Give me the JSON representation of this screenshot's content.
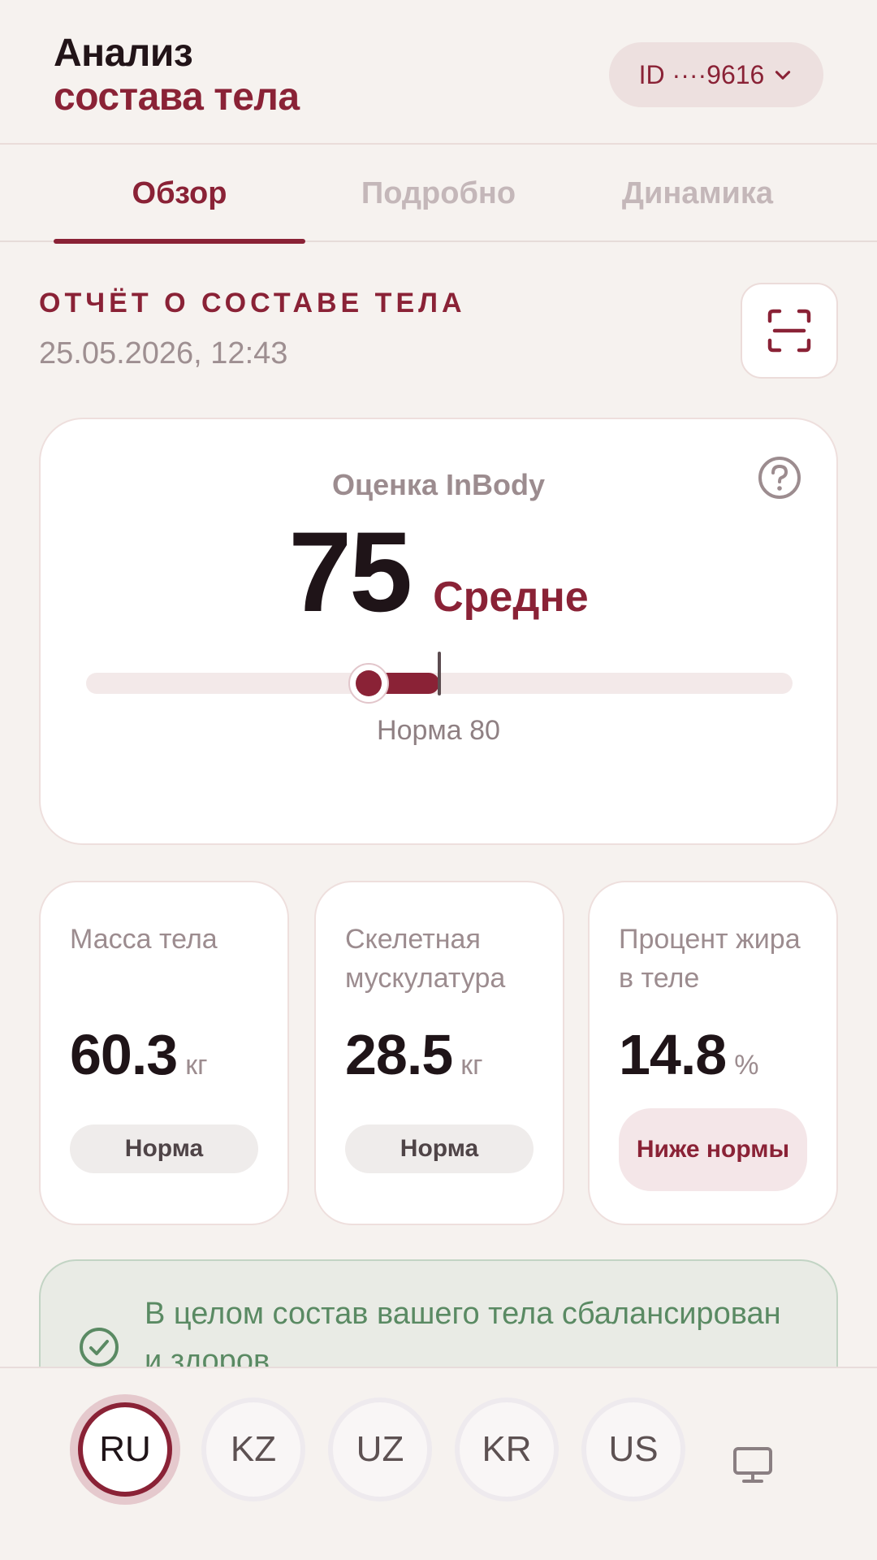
{
  "header": {
    "title_line1": "Анализ",
    "title_line2": "состава тела",
    "id_label": "ID ····9616"
  },
  "tabs": [
    {
      "label": "Обзор",
      "active": true
    },
    {
      "label": "Подробно",
      "active": false
    },
    {
      "label": "Динамика",
      "active": false
    }
  ],
  "report": {
    "title": "ОТЧЁТ О СОСТАВЕ ТЕЛА",
    "date": "25.05.2026, 12:43"
  },
  "score": {
    "label": "Оценка InBody",
    "value": "75",
    "rating": "Средне",
    "norm_text": "Норма 80",
    "value_num": 75,
    "norm_num": 80
  },
  "metrics": [
    {
      "label": "Масса тела",
      "value": "60.3",
      "unit": "кг",
      "status": "Норма"
    },
    {
      "label": "Скелетная мускулатура",
      "value": "28.5",
      "unit": "кг",
      "status": "Норма"
    },
    {
      "label": "Процент жира в теле",
      "value": "14.8",
      "unit": "%",
      "status": "Ниже нормы"
    }
  ],
  "summary": {
    "text": "В целом состав вашего тела сбалансирован и здоров"
  },
  "languages": [
    "RU",
    "KZ",
    "UZ",
    "KR",
    "US"
  ],
  "active_language": "RU",
  "colors": {
    "accent": "#8a2236",
    "background": "#f6f2ef",
    "success": "#5a8a63"
  }
}
